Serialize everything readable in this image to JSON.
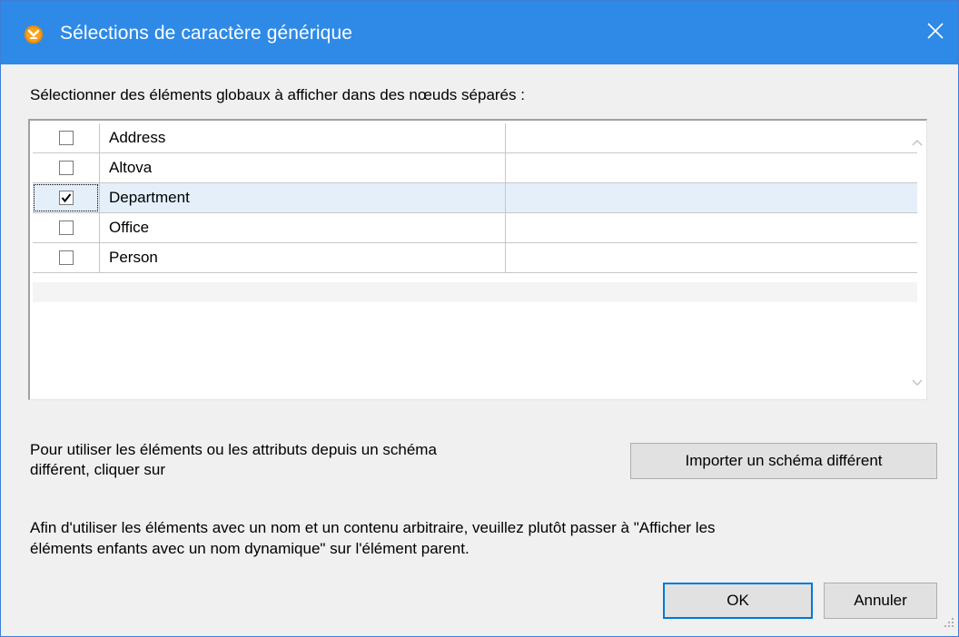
{
  "window": {
    "title": "Sélections de caractère générique",
    "titlebar_color": "#2e8ae6",
    "app_icon": "altova-mapforce-icon",
    "close_icon": "close-icon"
  },
  "prompt": "Sélectionner des éléments globaux à afficher dans des nœuds séparés :",
  "list": {
    "items": [
      {
        "label": "Address",
        "checked": false
      },
      {
        "label": "Altova",
        "checked": false
      },
      {
        "label": "Department",
        "checked": true,
        "selected": true
      },
      {
        "label": "Office",
        "checked": false
      },
      {
        "label": "Person",
        "checked": false
      }
    ],
    "scroll_up_icon": "chevron-up-icon",
    "scroll_down_icon": "chevron-down-icon"
  },
  "import_info": {
    "line1": "Pour utiliser les éléments ou les attributs depuis un schéma",
    "line2": "différent, cliquer sur"
  },
  "import_button": "Importer un schéma différent",
  "wildcard_info": {
    "line1": "Afin d'utiliser les éléments avec un nom et un contenu arbitraire, veuillez plutôt passer à \"Afficher les",
    "line2": "éléments enfants avec un nom dynamique\" sur l'élément parent."
  },
  "buttons": {
    "ok": "OK",
    "cancel": "Annuler"
  },
  "colors": {
    "accent": "#0078d7",
    "selected_row": "#e4effa"
  }
}
